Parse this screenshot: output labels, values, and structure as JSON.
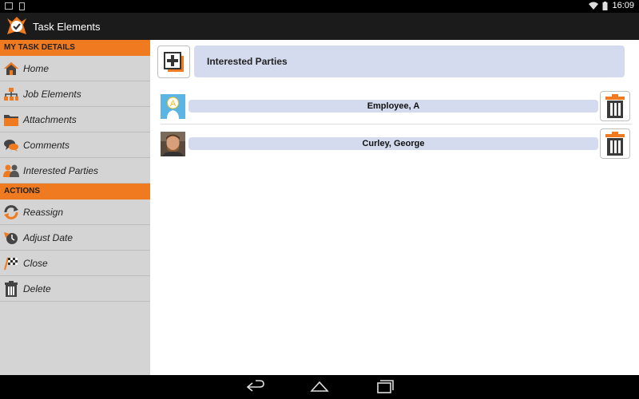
{
  "status_bar": {
    "time": "16:09"
  },
  "action_bar": {
    "title": "Task Elements"
  },
  "sidebar": {
    "section_details": "MY TASK DETAILS",
    "detail_items": [
      {
        "label": "Home",
        "icon": "home-icon"
      },
      {
        "label": "Job Elements",
        "icon": "org-chart-icon"
      },
      {
        "label": "Attachments",
        "icon": "folder-icon"
      },
      {
        "label": "Comments",
        "icon": "comments-icon"
      },
      {
        "label": "Interested Parties",
        "icon": "people-icon"
      }
    ],
    "section_actions": "ACTIONS",
    "action_items": [
      {
        "label": "Reassign",
        "icon": "reassign-icon"
      },
      {
        "label": "Adjust Date",
        "icon": "adjust-date-icon"
      },
      {
        "label": "Close",
        "icon": "checkered-flag-icon"
      },
      {
        "label": "Delete",
        "icon": "trash-icon"
      }
    ]
  },
  "main": {
    "title": "Interested Parties",
    "parties": [
      {
        "name": "Employee, A",
        "avatar": "letter-a-avatar"
      },
      {
        "name": "Curley, George",
        "avatar": "photo-avatar"
      }
    ]
  },
  "colors": {
    "accent": "#f07a1f",
    "sidebar_bg": "#d4d4d4",
    "bar_bg": "#d5dbee"
  }
}
